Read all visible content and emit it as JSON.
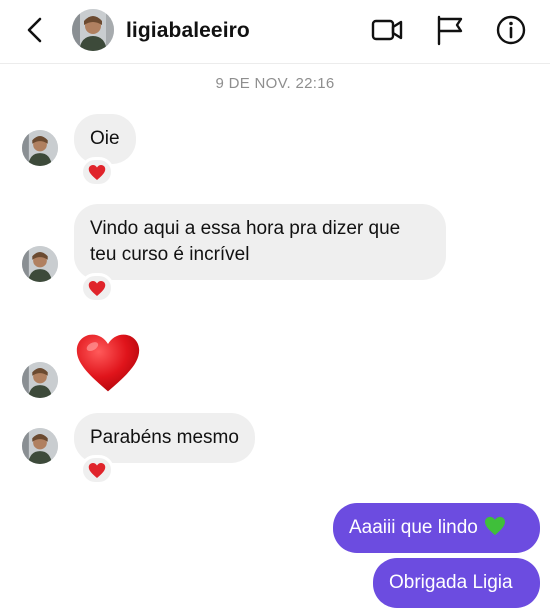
{
  "header": {
    "username": "ligiabaleeiro"
  },
  "timestamp": "9 DE NOV. 22:16",
  "messages_in": [
    {
      "text": "Oie",
      "reaction": "red-heart"
    },
    {
      "text_line1": "Vindo aqui a essa hora pra dizer que",
      "text_line2": "teu curso é incrível",
      "reaction": "red-heart"
    },
    {
      "emoji": "red-heart"
    },
    {
      "text": "Parabéns mesmo",
      "reaction": "red-heart"
    }
  ],
  "messages_out": [
    {
      "text": "Aaaiii que lindo",
      "emoji": "green-heart"
    },
    {
      "text": "Obrigada Ligia"
    }
  ],
  "colors": {
    "incoming_bubble": "#efefef",
    "outgoing_bubble": "#6c4ce0",
    "timestamp_text": "#8e8e8e"
  }
}
